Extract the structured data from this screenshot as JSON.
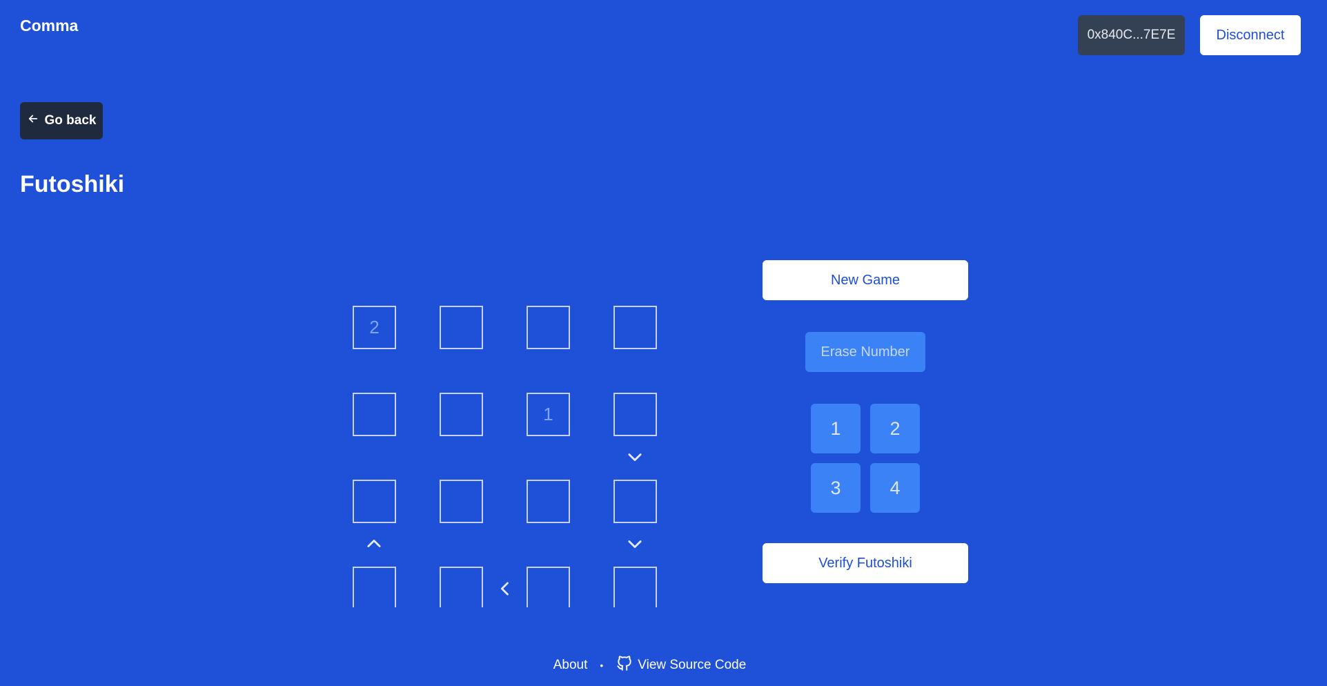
{
  "header": {
    "brand": "Comma",
    "address": "0x840C...7E7E",
    "disconnect_label": "Disconnect"
  },
  "nav": {
    "go_back_label": "Go back"
  },
  "page": {
    "title": "Futoshiki"
  },
  "board": {
    "size": 4,
    "cells": [
      [
        "2",
        "",
        "",
        ""
      ],
      [
        "",
        "",
        "1",
        ""
      ],
      [
        "",
        "",
        "",
        ""
      ],
      [
        "",
        "",
        "",
        ""
      ]
    ],
    "inequalities": [
      {
        "name": "row2-col4-down",
        "icon": "chevron-down-icon"
      },
      {
        "name": "row3-col1-up",
        "icon": "chevron-up-icon"
      },
      {
        "name": "row3-col4-down",
        "icon": "chevron-down-icon"
      },
      {
        "name": "row4-col2-col3-left",
        "icon": "chevron-left-icon"
      }
    ]
  },
  "controls": {
    "new_game_label": "New Game",
    "erase_label": "Erase Number",
    "numbers": [
      "1",
      "2",
      "3",
      "4"
    ],
    "verify_label": "Verify Futoshiki"
  },
  "footer": {
    "about_label": "About",
    "separator": "•",
    "source_label": "View Source Code"
  },
  "colors": {
    "background": "#1e50d8",
    "address_bg": "#344154",
    "go_back_bg": "#1f2a3e",
    "accent_button": "#3b82f6",
    "link_blue": "#1e4ed4"
  }
}
